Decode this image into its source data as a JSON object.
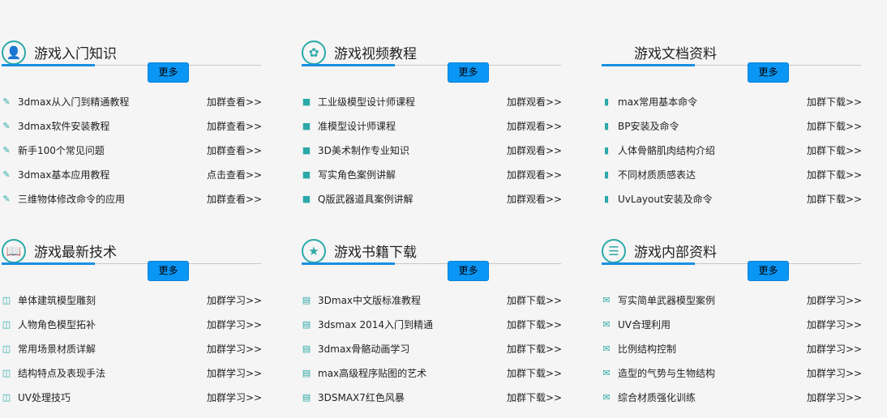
{
  "sections": [
    {
      "title": "游戏入门知识",
      "icon": "user-icon",
      "more": "更多",
      "item_icon": "feather-icon",
      "items": [
        {
          "text": "3dmax从入门到精通教程",
          "link": "加群查看>>"
        },
        {
          "text": "3dmax软件安装教程",
          "link": "加群查看>>"
        },
        {
          "text": "新手100个常见问题",
          "link": "加群查看>>"
        },
        {
          "text": "3dmax基本应用教程",
          "link": "点击查看>>"
        },
        {
          "text": "三维物体修改命令的应用",
          "link": "加群查看>>"
        }
      ]
    },
    {
      "title": "游戏视频教程",
      "icon": "film-reel-icon",
      "more": "更多",
      "item_icon": "video-camera-icon",
      "items": [
        {
          "text": "工业级模型设计师课程",
          "link": "加群观看>>"
        },
        {
          "text": "准模型设计师课程",
          "link": "加群观看>>"
        },
        {
          "text": "3D美术制作专业知识",
          "link": "加群观看>>"
        },
        {
          "text": "写实角色案例讲解",
          "link": "加群观看>>"
        },
        {
          "text": "Q版武器道具案例讲解",
          "link": "加群观看>>"
        }
      ]
    },
    {
      "title": "游戏文档资料",
      "icon": "",
      "more": "更多",
      "item_icon": "bar-chart-icon",
      "items": [
        {
          "text": "max常用基本命令",
          "link": "加群下载>>"
        },
        {
          "text": "BP安装及命令",
          "link": "加群下载>>"
        },
        {
          "text": "人体骨骼肌肉结构介绍",
          "link": "加群下载>>"
        },
        {
          "text": "不同材质质感表达",
          "link": "加群下载>>"
        },
        {
          "text": "UvLayout安装及命令",
          "link": "加群下载>>"
        }
      ]
    },
    {
      "title": "游戏最新技术",
      "icon": "book-icon",
      "more": "更多",
      "item_icon": "chat-icon",
      "items": [
        {
          "text": "单体建筑模型雕刻",
          "link": "加群学习>>"
        },
        {
          "text": "人物角色模型拓补",
          "link": "加群学习>>"
        },
        {
          "text": "常用场景材质详解",
          "link": "加群学习>>"
        },
        {
          "text": "结构特点及表现手法",
          "link": "加群学习>>"
        },
        {
          "text": "UV处理技巧",
          "link": "加群学习>>"
        }
      ]
    },
    {
      "title": "游戏书籍下载",
      "icon": "document-star-icon",
      "more": "更多",
      "item_icon": "notebook-icon",
      "items": [
        {
          "text": "3Dmax中文版标准教程",
          "link": "加群下载>>"
        },
        {
          "text": "3dsmax 2014入门到精通",
          "link": "加群下载>>"
        },
        {
          "text": "3dmax骨骼动画学习",
          "link": "加群下载>>"
        },
        {
          "text": "max高级程序贴图的艺术",
          "link": "加群下载>>"
        },
        {
          "text": "3DSMAX7红色风暴",
          "link": "加群下载>>"
        }
      ]
    },
    {
      "title": "游戏内部资料",
      "icon": "list-icon",
      "more": "更多",
      "item_icon": "envelope-icon",
      "items": [
        {
          "text": "写实简单武器模型案例",
          "link": "加群学习>>"
        },
        {
          "text": "UV合理利用",
          "link": "加群学习>>"
        },
        {
          "text": "比例结构控制",
          "link": "加群学习>>"
        },
        {
          "text": "造型的气势与生物结构",
          "link": "加群学习>>"
        },
        {
          "text": "综合材质强化训练",
          "link": "加群学习>>"
        }
      ]
    }
  ]
}
